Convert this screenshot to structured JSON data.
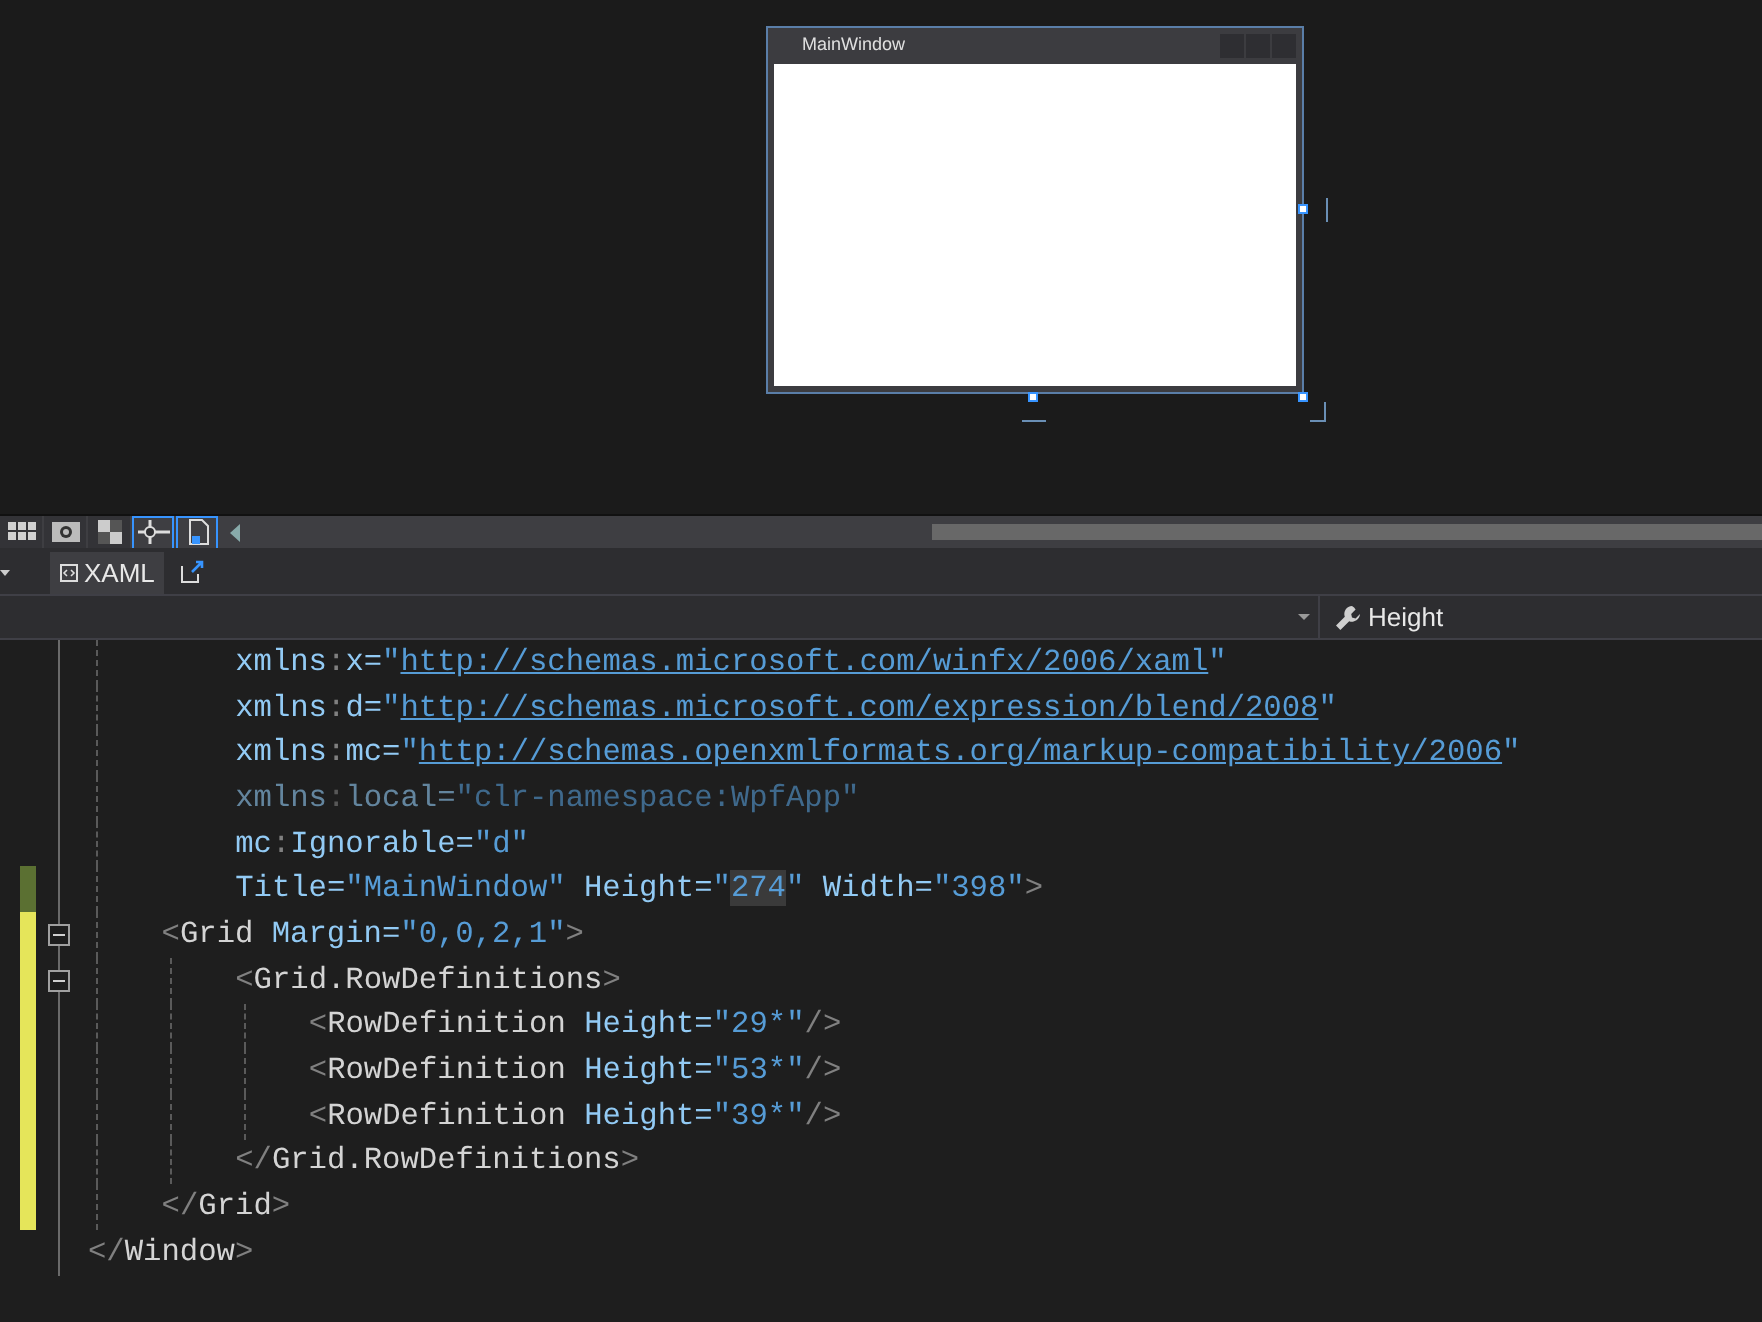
{
  "designer": {
    "window_title": "MainWindow"
  },
  "tools": [
    {
      "kind": "grid",
      "selected": false
    },
    {
      "kind": "effects",
      "selected": false
    },
    {
      "kind": "checker",
      "selected": false
    },
    {
      "kind": "snap",
      "selected": true
    },
    {
      "kind": "document",
      "selected": true
    }
  ],
  "tabs": [
    {
      "label": "XAML",
      "selected": true
    }
  ],
  "member_dropdown": {
    "value": "Height"
  },
  "code_lines": [
    {
      "kind": "attribute",
      "modified": false,
      "foldable": false,
      "faded": false,
      "tokens": [
        {
          "kind": "attr",
          "text": "xmlns"
        },
        {
          "kind": "punct",
          "text": ":"
        },
        {
          "kind": "attr",
          "text": "x="
        },
        {
          "kind": "value",
          "text": "\""
        },
        {
          "kind": "link",
          "text": "http://schemas.microsoft.com/winfx/2006/xaml"
        },
        {
          "kind": "value",
          "text": "\""
        }
      ]
    },
    {
      "kind": "attribute",
      "modified": false,
      "foldable": false,
      "faded": false,
      "tokens": [
        {
          "kind": "attr",
          "text": "xmlns"
        },
        {
          "kind": "punct",
          "text": ":"
        },
        {
          "kind": "attr",
          "text": "d="
        },
        {
          "kind": "value",
          "text": "\""
        },
        {
          "kind": "link",
          "text": "http://schemas.microsoft.com/expression/blend/2008"
        },
        {
          "kind": "value",
          "text": "\""
        }
      ]
    },
    {
      "kind": "attribute",
      "modified": false,
      "foldable": false,
      "faded": false,
      "tokens": [
        {
          "kind": "attr",
          "text": "xmlns"
        },
        {
          "kind": "punct",
          "text": ":"
        },
        {
          "kind": "attr",
          "text": "mc="
        },
        {
          "kind": "value",
          "text": "\""
        },
        {
          "kind": "link",
          "text": "http://schemas.openxmlformats.org/markup-compatibility/2006"
        },
        {
          "kind": "value",
          "text": "\""
        }
      ]
    },
    {
      "kind": "attribute",
      "modified": false,
      "foldable": false,
      "faded": true,
      "tokens": [
        {
          "kind": "attr",
          "text": "xmlns"
        },
        {
          "kind": "punct",
          "text": ":"
        },
        {
          "kind": "attr",
          "text": "local="
        },
        {
          "kind": "value",
          "text": "\"clr-namespace:WpfApp\""
        }
      ]
    },
    {
      "kind": "attribute",
      "modified": false,
      "foldable": false,
      "faded": false,
      "tokens": [
        {
          "kind": "attr",
          "text": "mc"
        },
        {
          "kind": "punct",
          "text": ":"
        },
        {
          "kind": "attr",
          "text": "Ignorable="
        },
        {
          "kind": "value",
          "text": "\"d\""
        }
      ]
    },
    {
      "kind": "attribute",
      "modified": true,
      "saved": true,
      "foldable": false,
      "faded": false,
      "tokens": [
        {
          "kind": "attr",
          "text": "Title="
        },
        {
          "kind": "value",
          "text": "\"MainWindow\""
        },
        {
          "kind": "attr",
          "text": " Height="
        },
        {
          "kind": "value",
          "text": "\""
        },
        {
          "kind": "marked",
          "text": "274"
        },
        {
          "kind": "value",
          "text": "\""
        },
        {
          "kind": "attr",
          "text": " Width="
        },
        {
          "kind": "value",
          "text": "\"398\""
        },
        {
          "kind": "punct",
          "text": ">"
        }
      ]
    },
    {
      "kind": "tag",
      "modified": true,
      "saved": false,
      "foldable": true,
      "faded": false,
      "tokens": [
        {
          "kind": "punct",
          "text": "<"
        },
        {
          "kind": "tag",
          "text": "Grid"
        },
        {
          "kind": "attr",
          "text": " Margin="
        },
        {
          "kind": "value",
          "text": "\"0,0,2,1\""
        },
        {
          "kind": "punct",
          "text": ">"
        }
      ],
      "children": [
        {
          "kind": "tag",
          "modified": true,
          "saved": false,
          "foldable": true,
          "faded": false,
          "tokens": [
            {
              "kind": "punct",
              "text": "<"
            },
            {
              "kind": "tag",
              "text": "Grid.RowDefinitions"
            },
            {
              "kind": "punct",
              "text": ">"
            }
          ],
          "children": [
            {
              "kind": "tag",
              "modified": true,
              "saved": false,
              "foldable": false,
              "faded": false,
              "tokens": [
                {
                  "kind": "punct",
                  "text": "<"
                },
                {
                  "kind": "tag",
                  "text": "RowDefinition"
                },
                {
                  "kind": "attr",
                  "text": " Height="
                },
                {
                  "kind": "value",
                  "text": "\"29*\""
                },
                {
                  "kind": "punct",
                  "text": "/>"
                }
              ]
            },
            {
              "kind": "tag",
              "modified": true,
              "saved": false,
              "foldable": false,
              "faded": false,
              "tokens": [
                {
                  "kind": "punct",
                  "text": "<"
                },
                {
                  "kind": "tag",
                  "text": "RowDefinition"
                },
                {
                  "kind": "attr",
                  "text": " Height="
                },
                {
                  "kind": "value",
                  "text": "\"53*\""
                },
                {
                  "kind": "punct",
                  "text": "/>"
                }
              ]
            },
            {
              "kind": "tag",
              "modified": true,
              "saved": false,
              "foldable": false,
              "faded": false,
              "tokens": [
                {
                  "kind": "punct",
                  "text": "<"
                },
                {
                  "kind": "tag",
                  "text": "RowDefinition"
                },
                {
                  "kind": "attr",
                  "text": " Height="
                },
                {
                  "kind": "value",
                  "text": "\"39*\""
                },
                {
                  "kind": "punct",
                  "text": "/>"
                }
              ]
            }
          ]
        },
        {
          "kind": "tag",
          "modified": true,
          "saved": false,
          "foldable": false,
          "faded": false,
          "tokens": [
            {
              "kind": "punct",
              "text": "</"
            },
            {
              "kind": "tag",
              "text": "Grid.RowDefinitions"
            },
            {
              "kind": "punct",
              "text": ">"
            }
          ]
        }
      ]
    },
    {
      "kind": "tag",
      "modified": true,
      "saved": false,
      "foldable": false,
      "faded": false,
      "tokens": [
        {
          "kind": "punct",
          "text": "</"
        },
        {
          "kind": "tag",
          "text": "Grid"
        },
        {
          "kind": "punct",
          "text": ">"
        }
      ]
    }
  ],
  "closing_line": {
    "modified": false,
    "foldable": false,
    "faded": false,
    "tokens": [
      {
        "kind": "punct",
        "text": "</"
      },
      {
        "kind": "tag",
        "text": "Window"
      },
      {
        "kind": "punct",
        "text": ">"
      }
    ]
  }
}
